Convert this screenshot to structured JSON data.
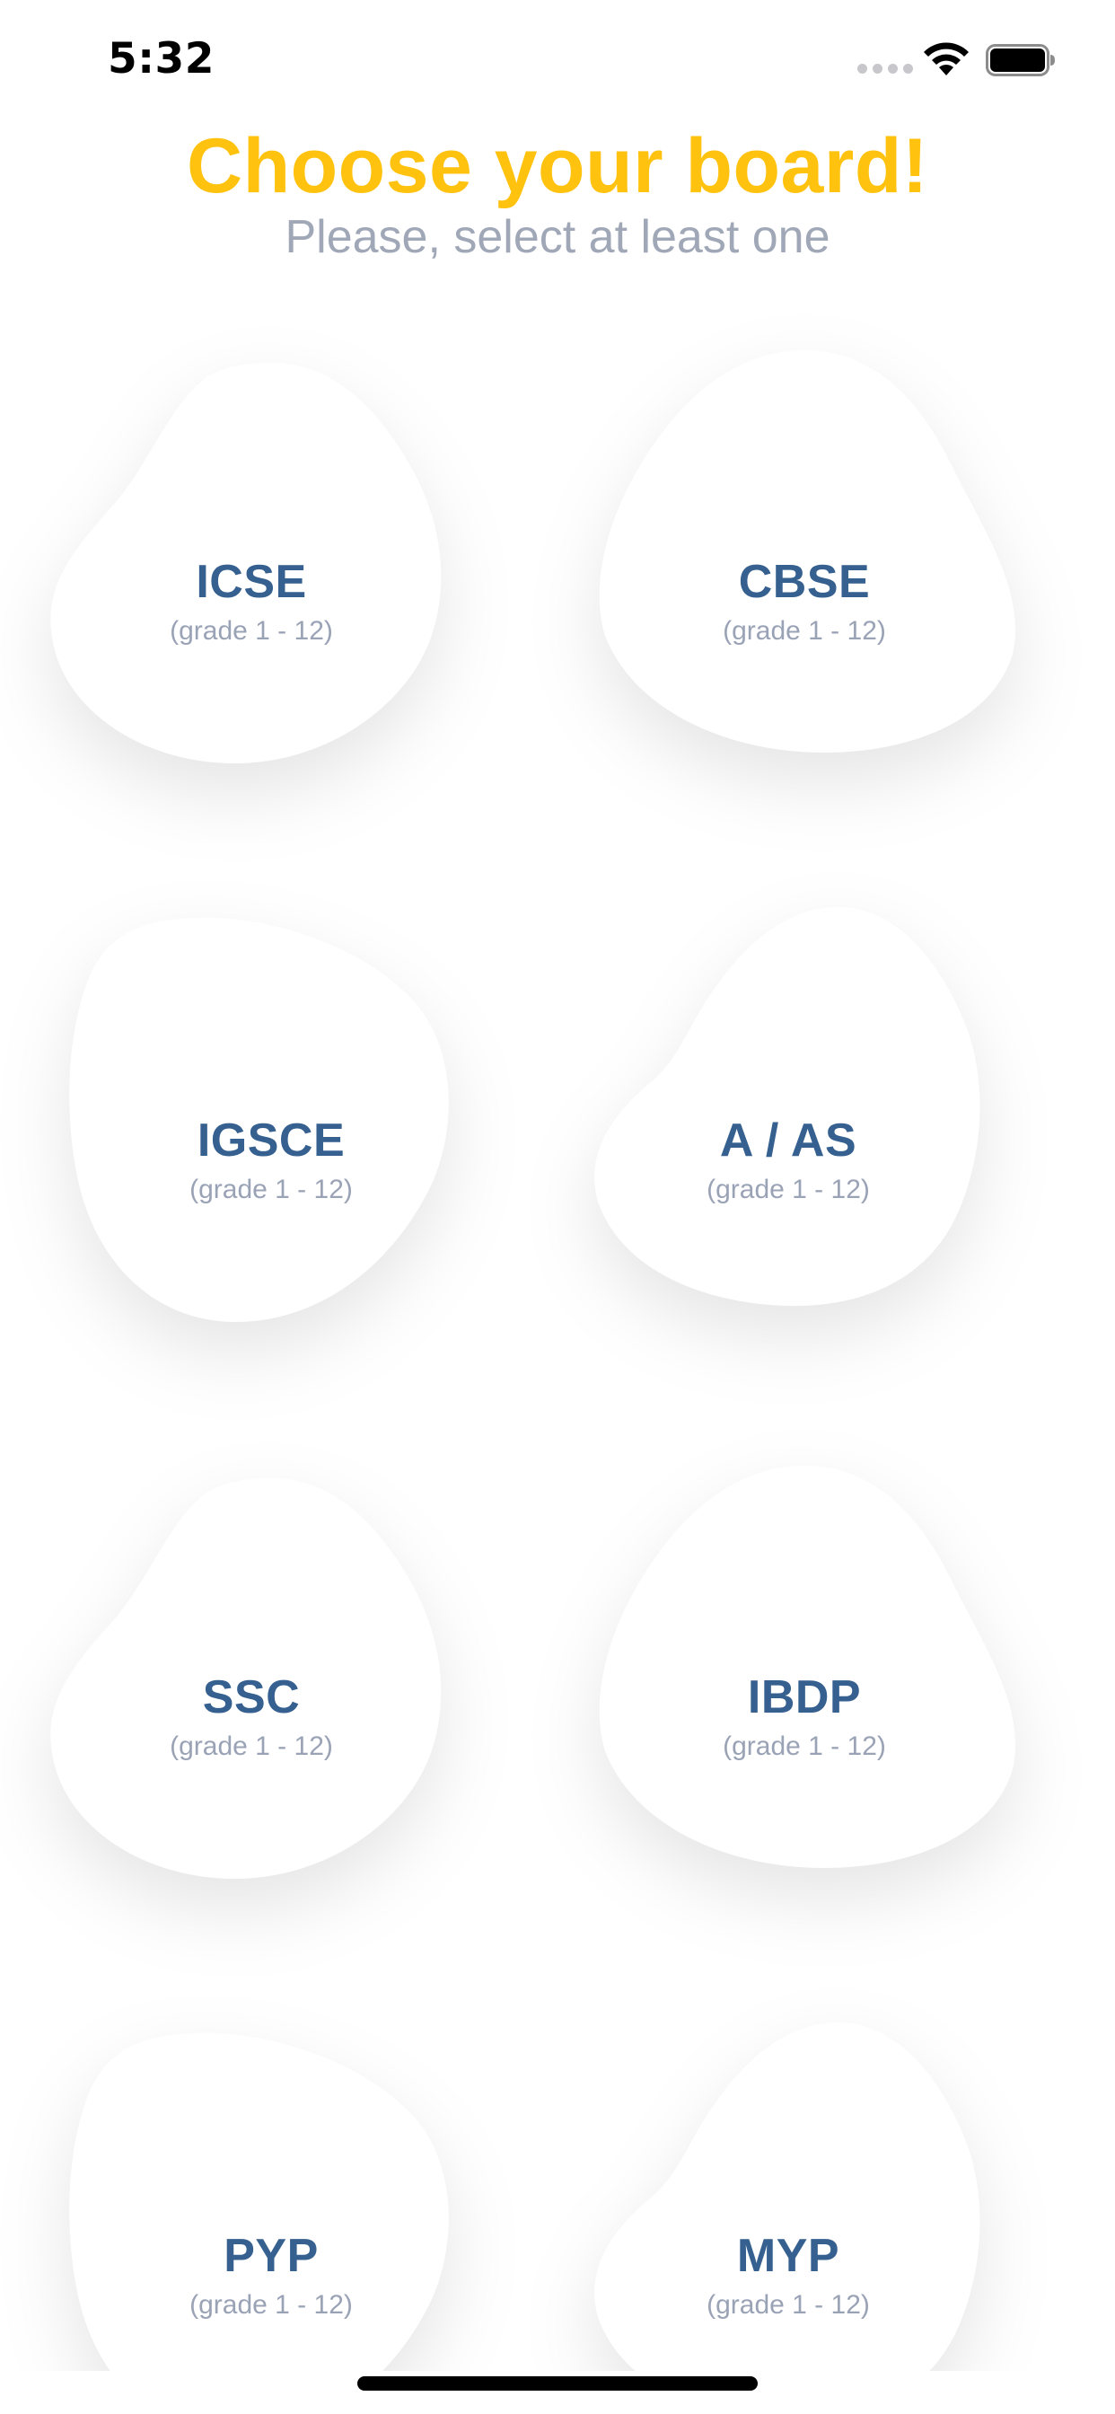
{
  "status_bar": {
    "time": "5:32",
    "icons": [
      "signal-dots-icon",
      "wifi-icon",
      "battery-icon"
    ]
  },
  "header": {
    "title": "Choose your board!",
    "subtitle": "Please, select at least one"
  },
  "boards": [
    {
      "name": "ICSE",
      "grade": "(grade 1 - 12)"
    },
    {
      "name": "CBSE",
      "grade": "(grade 1 - 12)"
    },
    {
      "name": "IGSCE",
      "grade": "(grade 1 - 12)"
    },
    {
      "name": "A / AS",
      "grade": "(grade 1 - 12)"
    },
    {
      "name": "SSC",
      "grade": "(grade 1 - 12)"
    },
    {
      "name": "IBDP",
      "grade": "(grade 1 - 12)"
    },
    {
      "name": "PYP",
      "grade": "(grade 1 - 12)"
    },
    {
      "name": "MYP",
      "grade": "(grade 1 - 12)"
    }
  ],
  "colors": {
    "title": "#ffc20e",
    "subtitle": "#a0a8b8",
    "board_name": "#35608f",
    "board_grade": "#9aa3b6",
    "card_background": "#ffffff"
  }
}
